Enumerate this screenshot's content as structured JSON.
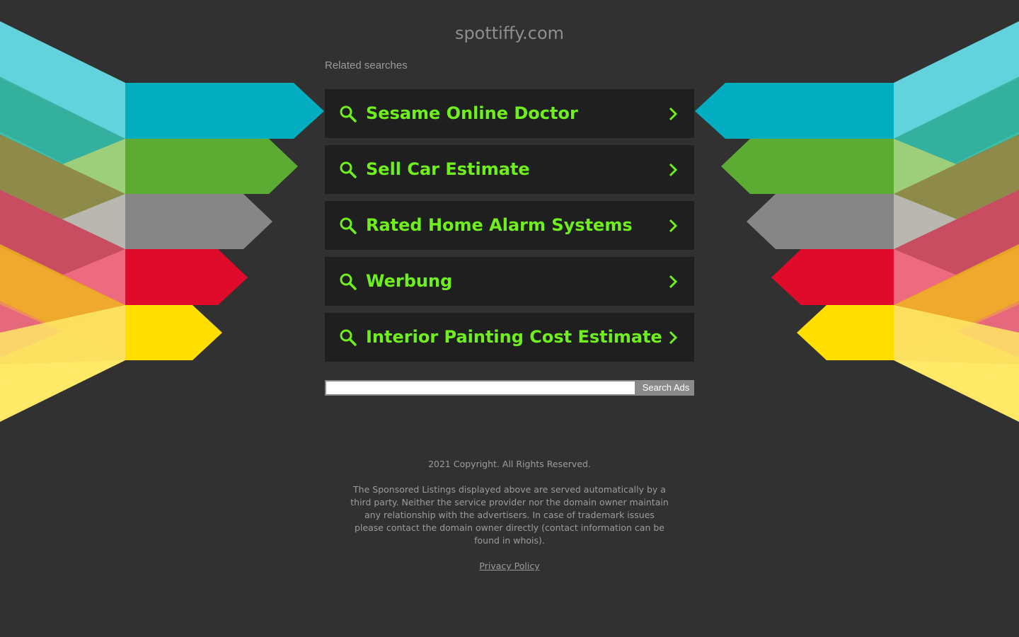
{
  "header": {
    "domain": "spottiffy.com",
    "related_label": "Related searches"
  },
  "ads": [
    {
      "label": "Sesame Online Doctor"
    },
    {
      "label": "Sell Car Estimate"
    },
    {
      "label": "Rated Home Alarm Systems"
    },
    {
      "label": "Werbung"
    },
    {
      "label": "Interior Painting Cost Estimate"
    }
  ],
  "search": {
    "value": "",
    "button_label": "Search Ads"
  },
  "footer": {
    "copyright": "2021 Copyright. All Rights Reserved.",
    "disclaimer": "The Sponsored Listings displayed above are served automatically by a third party. Neither the service provider nor the domain owner maintain any relationship with the advertisers. In case of trademark issues please contact the domain owner directly (contact information can be found in whois).",
    "privacy_link": "Privacy Policy"
  },
  "icons": {
    "search": "search-icon",
    "chevron": "chevron-right-icon"
  },
  "colors": {
    "background": "#313131",
    "accent_text": "#6ff01b",
    "ad_row": "#1f1f1f",
    "band_cyan": "#01adbf",
    "band_green": "#5cab32",
    "band_gray": "#868686",
    "band_red": "#e00b2b",
    "band_yellow": "#ffde00"
  }
}
